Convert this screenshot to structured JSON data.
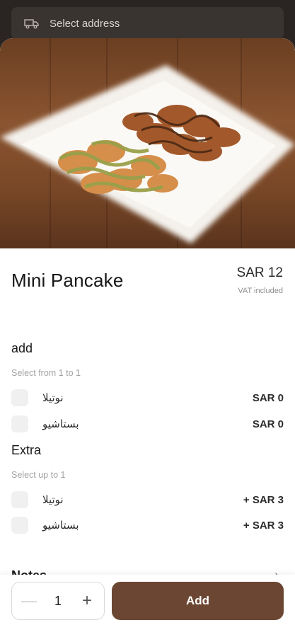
{
  "header": {
    "address_label": "Select address",
    "address_icon": "truck-icon"
  },
  "product": {
    "name": "Mini Pancake",
    "price": "SAR 12",
    "vat_note": "VAT included"
  },
  "groups": [
    {
      "title": "add",
      "hint": "Select from 1 to 1",
      "options": [
        {
          "label": "نوتيلا",
          "price": "SAR 0"
        },
        {
          "label": "بستاشيو",
          "price": "SAR 0"
        }
      ]
    },
    {
      "title": "Extra",
      "hint": "Select up to 1",
      "options": [
        {
          "label": "نوتيلا",
          "price": "+ SAR 3"
        },
        {
          "label": "بستاشيو",
          "price": "+ SAR 3"
        }
      ]
    }
  ],
  "notes": {
    "title": "Notes"
  },
  "footer": {
    "quantity": "1",
    "minus_symbol": "—",
    "plus_symbol": "+",
    "add_label": "Add"
  },
  "colors": {
    "brand": "#6b4733",
    "checkbox": "#f0f0f0",
    "backdrop": "#2a2522"
  }
}
